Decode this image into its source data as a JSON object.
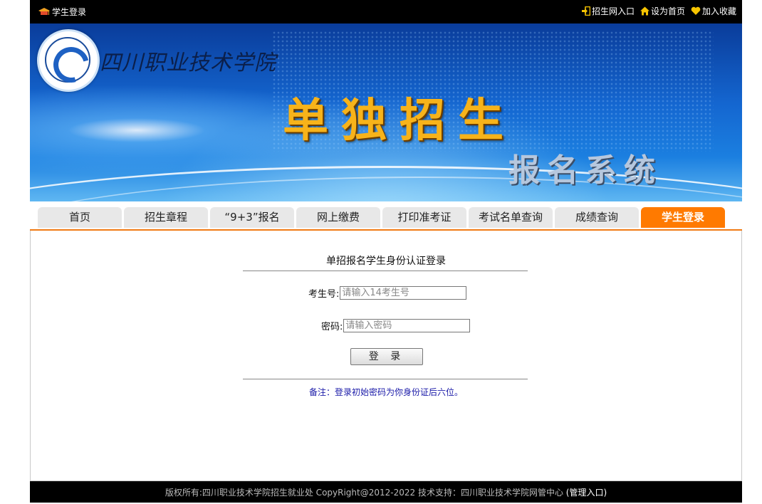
{
  "topbar": {
    "title": "学生登录",
    "links": [
      {
        "label": "招生网入口",
        "icon": "login-arrow-icon"
      },
      {
        "label": "设为首页",
        "icon": "home-icon"
      },
      {
        "label": "加入收藏",
        "icon": "heart-icon"
      }
    ]
  },
  "banner": {
    "college_name": "四川职业技术学院",
    "title": "单独招生",
    "subtitle": "报名系统"
  },
  "nav": {
    "tabs": [
      "首页",
      "招生章程",
      "“9+3”报名",
      "网上缴费",
      "打印准考证",
      "考试名单查询",
      "成绩查询",
      "学生登录"
    ],
    "active": "学生登录"
  },
  "login": {
    "title": "单招报名学生身份认证登录",
    "exam_no_label": "考生号:",
    "exam_no_placeholder": "请输入14考生号",
    "password_label": "密码:",
    "password_placeholder": "请输入密码",
    "button": "登 录",
    "note": "备注：登录初始密码为你身份证后六位。"
  },
  "footer": {
    "text": "版权所有:四川职业技术学院招生就业处  CopyRight@2012-2022  技术支持：四川职业技术学院网管中心",
    "admin_link": "(管理入口)"
  },
  "colors": {
    "accent": "#ff7a00",
    "topbar_bg": "#000000",
    "tab_bg": "#e8e8e8",
    "note_color": "#1a1aa8"
  }
}
